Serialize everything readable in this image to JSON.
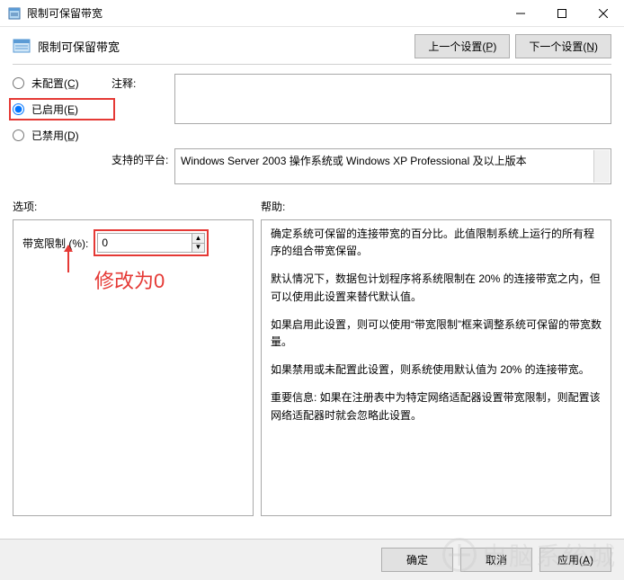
{
  "titlebar": {
    "title": "限制可保留带宽"
  },
  "header": {
    "title": "限制可保留带宽",
    "prev_btn": "上一个设置(P̲)",
    "next_btn": "下一个设置(N̲)"
  },
  "radios": {
    "not_configured": "未配置(C̲)",
    "enabled": "已启用(E̲)",
    "disabled": "已禁用(D̲)",
    "selected": "enabled"
  },
  "labels": {
    "comment": "注释:",
    "platform": "支持的平台:",
    "options": "选项:",
    "help": "帮助:"
  },
  "comment_value": "",
  "platform_value": "Windows Server 2003 操作系统或 Windows XP Professional 及以上版本",
  "options": {
    "bandwidth_label": "带宽限制 (%):",
    "bandwidth_value": "0",
    "annotation": "修改为0"
  },
  "help_text": {
    "p1": "确定系统可保留的连接带宽的百分比。此值限制系统上运行的所有程序的组合带宽保留。",
    "p2": "默认情况下，数据包计划程序将系统限制在 20% 的连接带宽之内，但可以使用此设置来替代默认值。",
    "p3": "如果启用此设置，则可以使用“带宽限制”框来调整系统可保留的带宽数量。",
    "p4": "如果禁用或未配置此设置，则系统使用默认值为 20% 的连接带宽。",
    "p5": "重要信息: 如果在注册表中为特定网络适配器设置带宽限制，则配置该网络适配器时就会忽略此设置。"
  },
  "footer": {
    "ok": "确定",
    "cancel": "取消",
    "apply": "应用(A̲)"
  },
  "watermark": "电脑系统城"
}
